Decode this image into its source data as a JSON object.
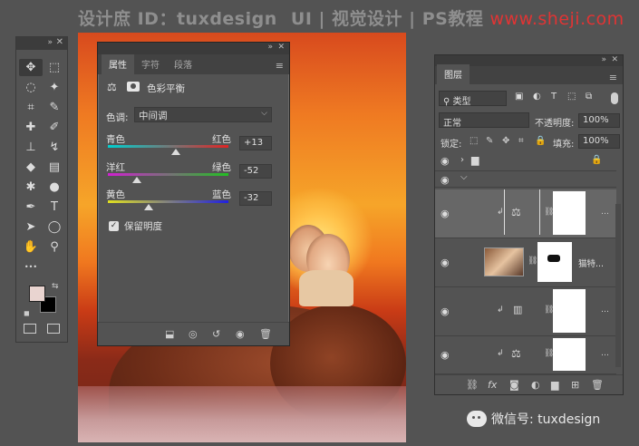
{
  "watermark": {
    "site": "设计庶 ID：tuxdesign",
    "section": "UI | 视觉设计 | PS教程",
    "url": "www.sheji.com"
  },
  "tools_panel": {
    "collapse_glyph": "»",
    "close_glyph": "✕",
    "tools": [
      {
        "name": "move-tool-icon",
        "glyph": "✥",
        "selected": true
      },
      {
        "name": "marquee-tool-icon",
        "glyph": "⬚"
      },
      {
        "name": "lasso-tool-icon",
        "glyph": "◌"
      },
      {
        "name": "magic-wand-tool-icon",
        "glyph": "✦"
      },
      {
        "name": "crop-tool-icon",
        "glyph": "⌗"
      },
      {
        "name": "eyedropper-tool-icon",
        "glyph": "✎"
      },
      {
        "name": "healing-brush-tool-icon",
        "glyph": "✚"
      },
      {
        "name": "brush-tool-icon",
        "glyph": "✐"
      },
      {
        "name": "stamp-tool-icon",
        "glyph": "⊥"
      },
      {
        "name": "history-brush-tool-icon",
        "glyph": "↯"
      },
      {
        "name": "eraser-tool-icon",
        "glyph": "◆"
      },
      {
        "name": "gradient-tool-icon",
        "glyph": "▤"
      },
      {
        "name": "blur-tool-icon",
        "glyph": "✱"
      },
      {
        "name": "dodge-tool-icon",
        "glyph": "●"
      },
      {
        "name": "pen-tool-icon",
        "glyph": "✒"
      },
      {
        "name": "type-tool-icon",
        "glyph": "T"
      },
      {
        "name": "path-selection-tool-icon",
        "glyph": "➤"
      },
      {
        "name": "ellipse-tool-icon",
        "glyph": "◯"
      },
      {
        "name": "hand-tool-icon",
        "glyph": "✋"
      },
      {
        "name": "zoom-tool-icon",
        "glyph": "⚲"
      },
      {
        "name": "more-tools-icon",
        "glyph": "•••"
      }
    ],
    "foreground_color": "#e9d4d0",
    "background_color": "#000000"
  },
  "properties_panel": {
    "collapse_glyph": "»",
    "close_glyph": "✕",
    "tabs": [
      "属性",
      "字符",
      "段落"
    ],
    "active_tab": "属性",
    "adjustment_title": "色彩平衡",
    "tone_label": "色调:",
    "tone_value": "中间调",
    "sliders": [
      {
        "left": "青色",
        "right": "红色",
        "value": "+13",
        "left_color": "#00d5d5",
        "right_color": "#e02020"
      },
      {
        "left": "洋红",
        "right": "绿色",
        "value": "-52",
        "left_color": "#d020d0",
        "right_color": "#20c020"
      },
      {
        "left": "黄色",
        "right": "蓝色",
        "value": "-32",
        "left_color": "#e0e020",
        "right_color": "#2020e0"
      }
    ],
    "slider_levels": [
      0.565,
      0.24,
      0.34
    ],
    "preserve_luminosity_label": "保留明度",
    "preserve_luminosity_checked": true
  },
  "layers_panel": {
    "collapse_glyph": "»",
    "close_glyph": "✕",
    "tab": "图层",
    "filter_label": "类型",
    "blend_mode": "正常",
    "opacity_label": "不透明度:",
    "opacity_value": "100%",
    "lock_label": "锁定:",
    "fill_label": "填充:",
    "fill_value": "100%",
    "layers": [
      {
        "type": "group",
        "name": ""
      },
      {
        "type": "group-open",
        "name": ""
      },
      {
        "type": "color-balance-adjustment",
        "name": "",
        "selected": true
      },
      {
        "type": "smart-object",
        "name": "猫特..."
      },
      {
        "type": "levels-adjustment",
        "name": ""
      },
      {
        "type": "color-balance-adjustment",
        "name": ""
      }
    ]
  },
  "wechat": {
    "label": "微信号: tuxdesign"
  }
}
